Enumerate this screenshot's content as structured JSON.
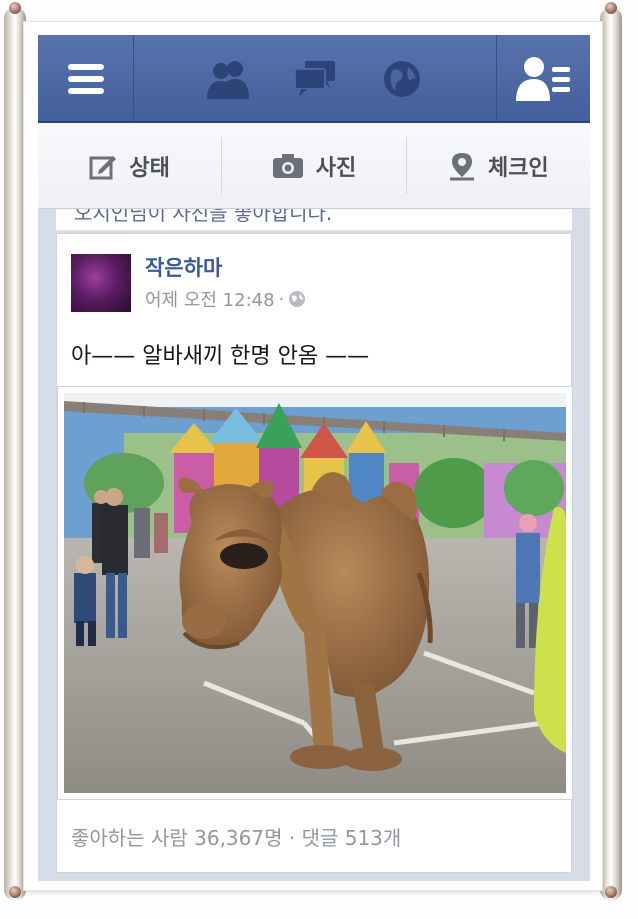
{
  "header": {
    "menu_icon": "menu-icon",
    "icons": [
      "friend-requests-icon",
      "messages-icon",
      "notifications-globe-icon",
      "friends-list-icon"
    ]
  },
  "composer": {
    "status_label": "상태",
    "photo_label": "사진",
    "checkin_label": "체크인"
  },
  "feed": {
    "prior_story_text": "오지인님이 사진을 좋아합니다.",
    "post": {
      "author": "작은하마",
      "time": "어제 오전 12:48",
      "separator": "·",
      "privacy_icon": "globe-icon",
      "text": "아—— 알바새끼 한명 안옴 ——",
      "photo_description_icon": "photo",
      "likes_comments": "좋아하는 사람 36,367명 · 댓글 513개"
    }
  },
  "colors": {
    "header_blue": "#4c66a4",
    "link_blue": "#3b5998",
    "meta_gray": "#9197a3",
    "feed_bg": "#d6dde9"
  }
}
